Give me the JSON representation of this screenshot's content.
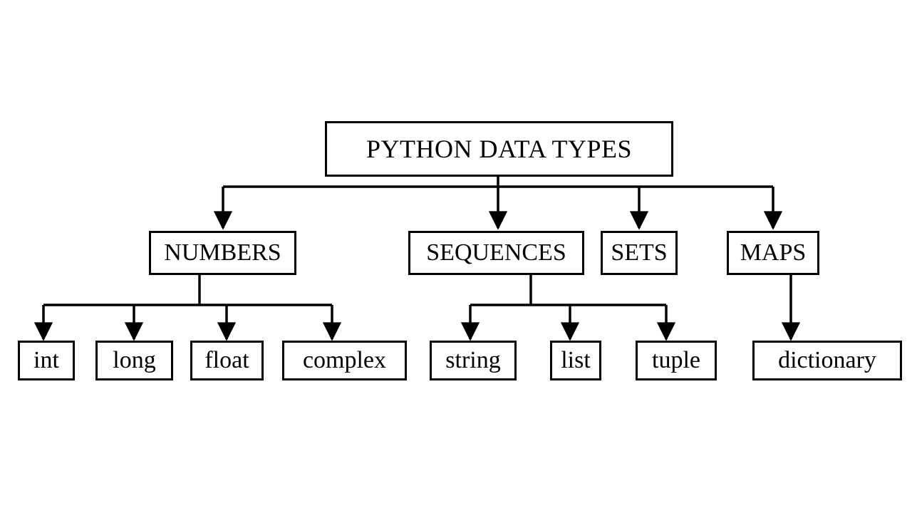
{
  "title": "PYTHON DATA TYPES",
  "categories": {
    "numbers": {
      "label": "NUMBERS",
      "children": [
        "int",
        "long",
        "float",
        "complex"
      ]
    },
    "sequences": {
      "label": "SEQUENCES",
      "children": [
        "string",
        "list",
        "tuple"
      ]
    },
    "sets": {
      "label": "SETS",
      "children": []
    },
    "maps": {
      "label": "MAPS",
      "children": [
        "dictionary"
      ]
    }
  }
}
